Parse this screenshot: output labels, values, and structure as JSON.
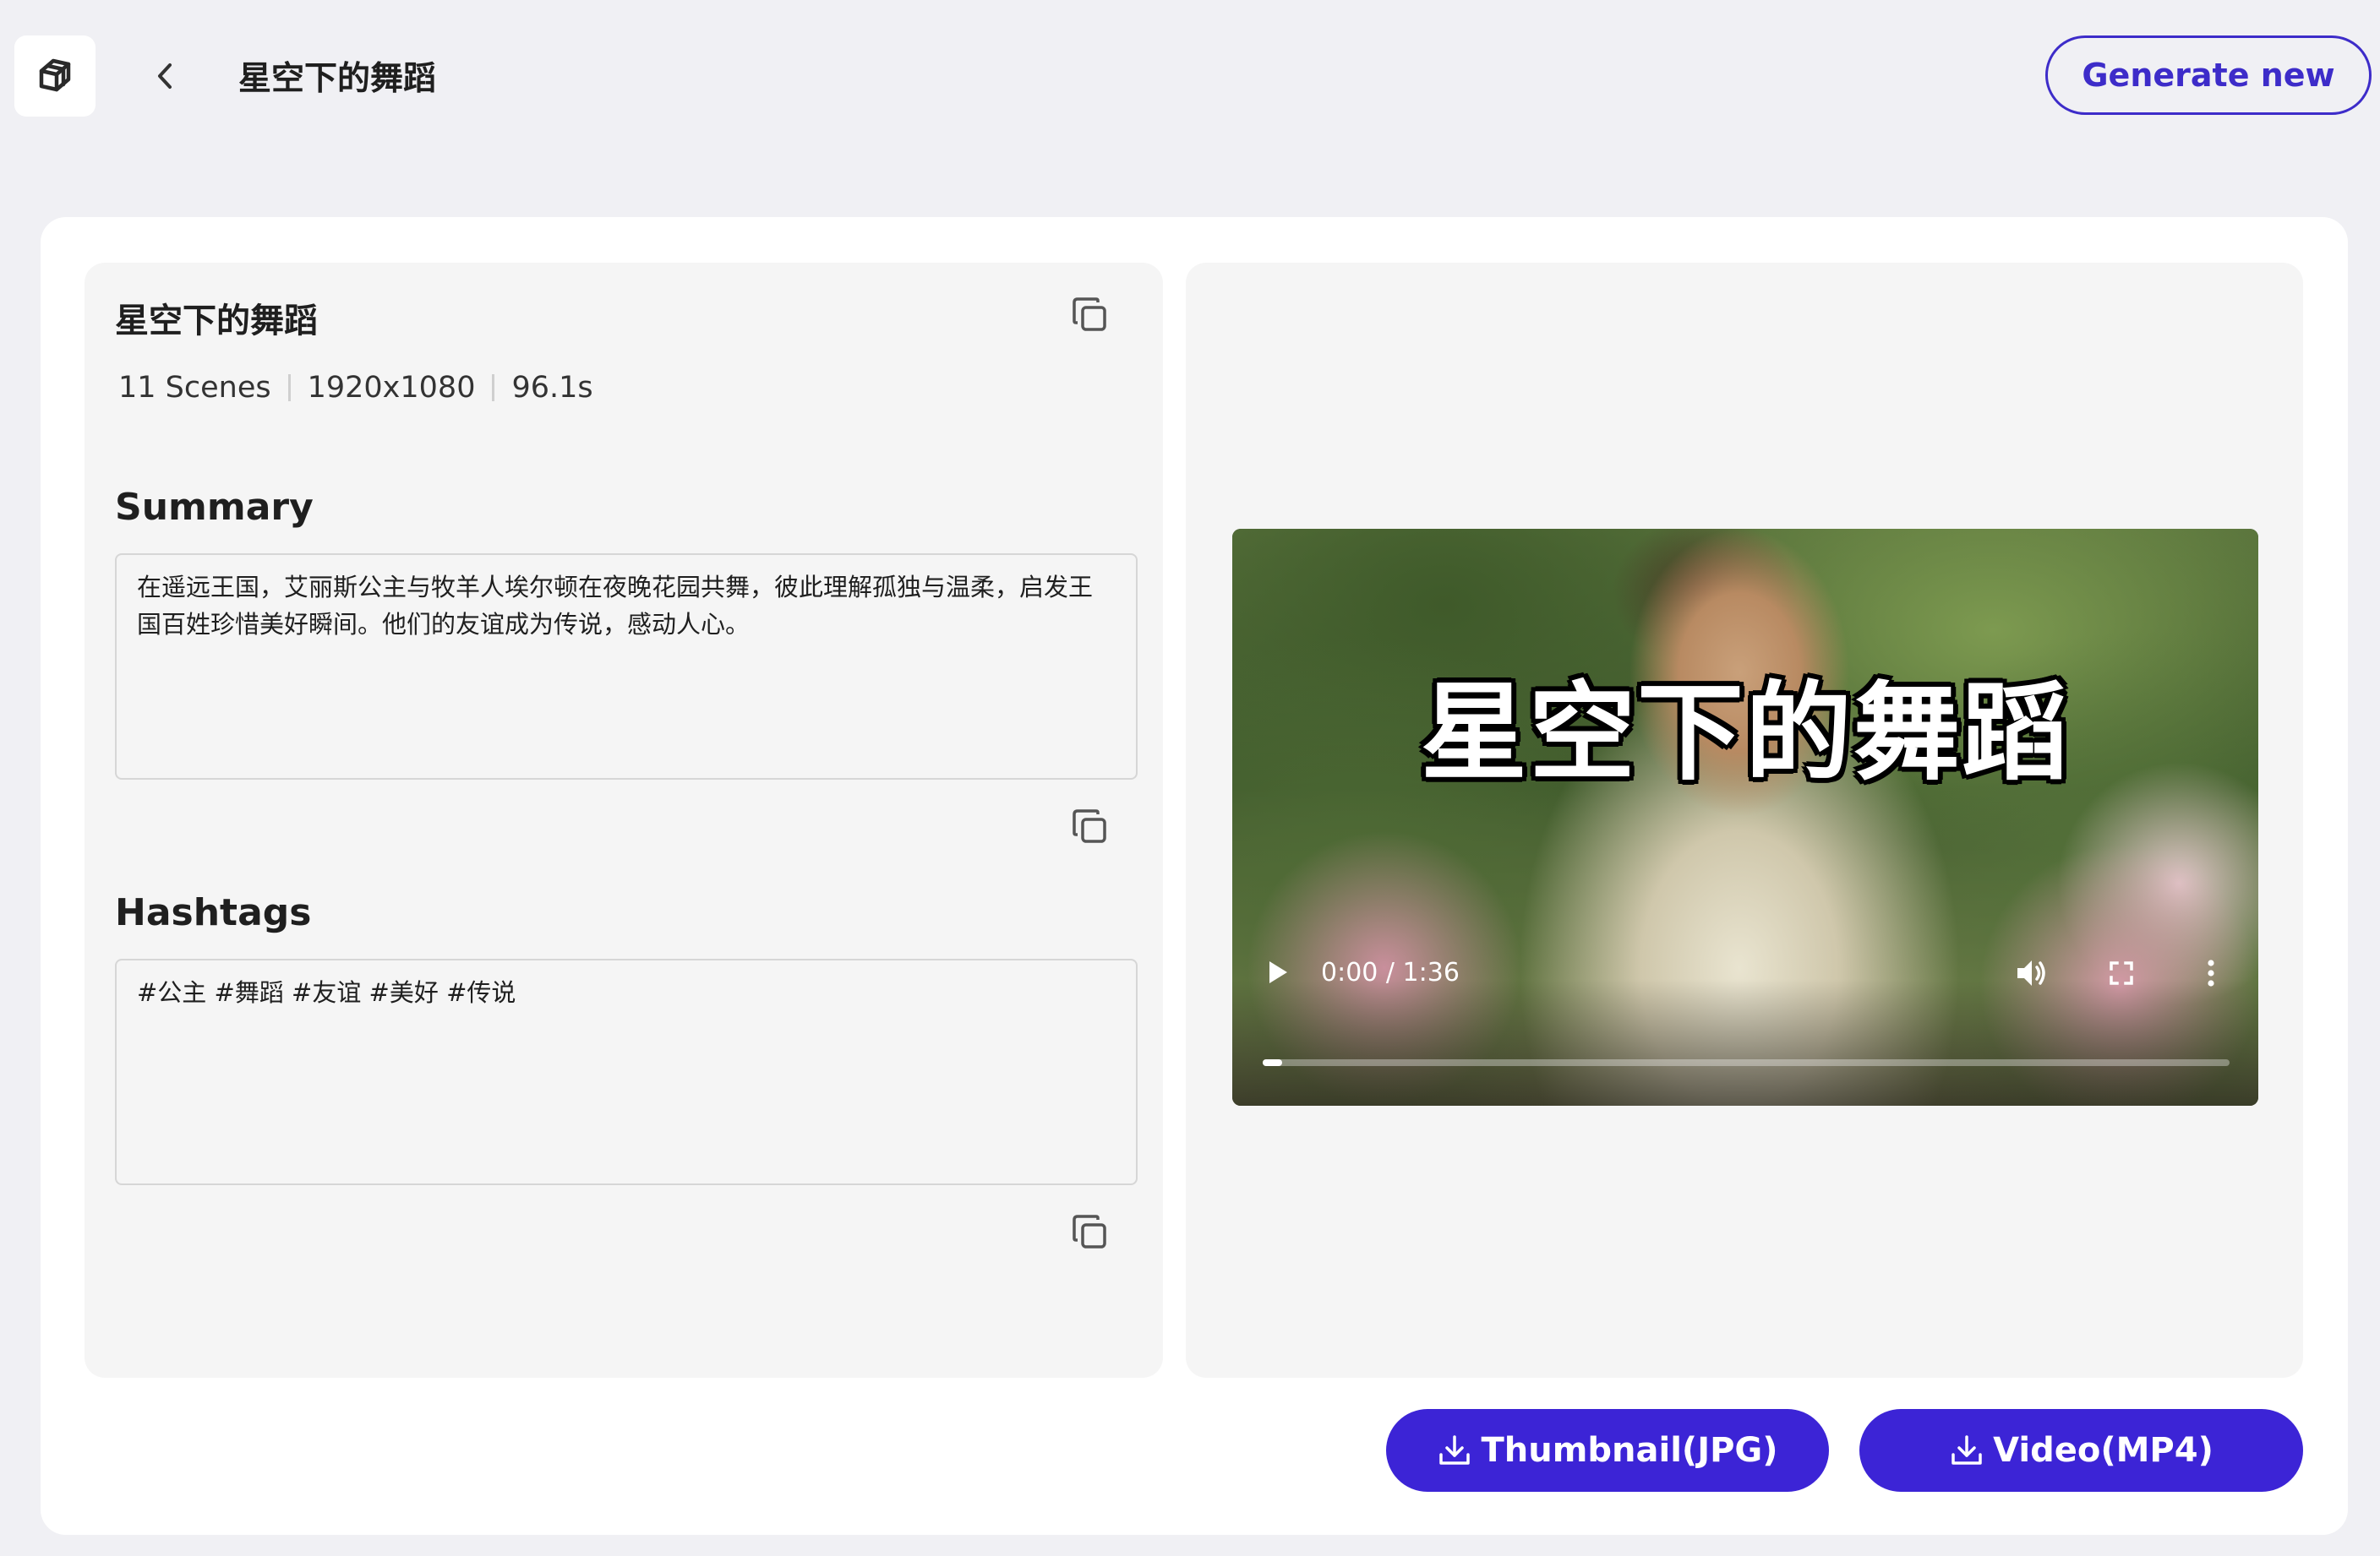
{
  "header": {
    "title": "星空下的舞蹈",
    "generate_label": "Generate new"
  },
  "story": {
    "title": "星空下的舞蹈",
    "meta": {
      "scenes": "11 Scenes",
      "resolution": "1920x1080",
      "duration": "96.1s"
    }
  },
  "summary": {
    "heading": "Summary",
    "text": "在遥远王国，艾丽斯公主与牧羊人埃尔顿在夜晚花园共舞，彼此理解孤独与温柔，启发王国百姓珍惜美好瞬间。他们的友谊成为传说，感动人心。"
  },
  "hashtags": {
    "heading": "Hashtags",
    "text": "#公主 #舞蹈 #友谊 #美好 #传说"
  },
  "video": {
    "overlay_title": "星空下的舞蹈",
    "time": "0:00 / 1:36",
    "progress": 0.02
  },
  "downloads": {
    "thumbnail_label": "Thumbnail(JPG)",
    "video_label": "Video(MP4)"
  },
  "colors": {
    "accent": "#3c24d6",
    "outline_accent": "#3d2cc9",
    "page_bg": "#f0f0f4",
    "panel_bg": "#f5f5f5"
  },
  "icons": {
    "logo": "cube-logo-icon",
    "back": "chevron-left-icon",
    "copy": "copy-icon",
    "play": "play-icon",
    "volume": "volume-icon",
    "fullscreen": "fullscreen-icon",
    "more": "more-vertical-icon",
    "download": "download-icon"
  }
}
